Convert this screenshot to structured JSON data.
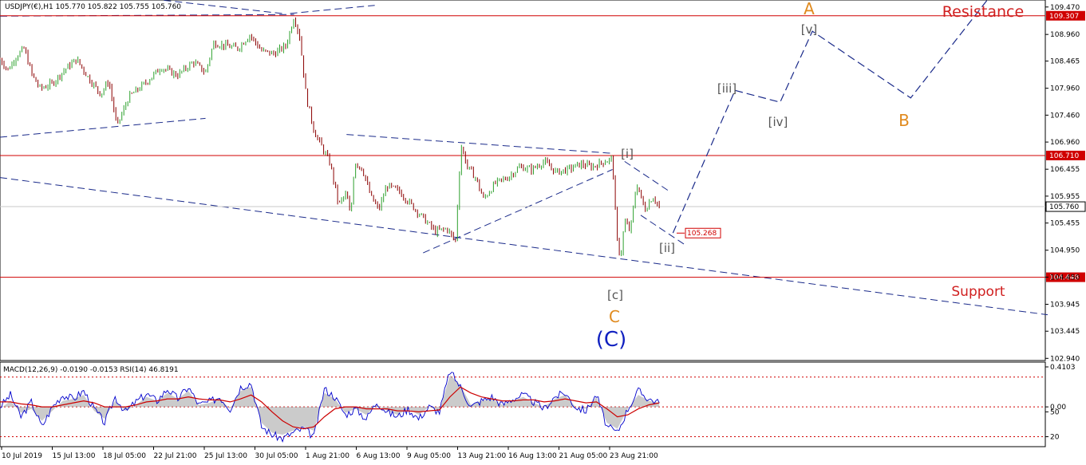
{
  "chart_data": [
    {
      "type": "candlestick",
      "symbol_header": "USDJPY(€),H1  105.770 105.822 105.755 105.760",
      "ylim": [
        102.9,
        109.6
      ],
      "price_ticks": [
        "109.470",
        "108.960",
        "108.465",
        "107.960",
        "107.460",
        "106.960",
        "106.455",
        "105.955",
        "105.455",
        "104.950",
        "104.450",
        "103.945",
        "103.445",
        "102.940"
      ],
      "x_labels": [
        "10 Jul 2019",
        "15 Jul 13:00",
        "18 Jul 05:00",
        "22 Jul 21:00",
        "25 Jul 13:00",
        "30 Jul 05:00",
        "1 Aug 21:00",
        "6 Aug 13:00",
        "9 Aug 05:00",
        "13 Aug 21:00",
        "16 Aug 13:00",
        "21 Aug 05:00",
        "23 Aug 21:00"
      ],
      "horizontal_levels": [
        {
          "value": 109.307,
          "label": "109.307",
          "color": "#d00000"
        },
        {
          "value": 106.71,
          "label": "106.710",
          "color": "#d00000"
        },
        {
          "value": 104.448,
          "label": "104.448",
          "color": "#d00000"
        },
        {
          "value": 105.268,
          "label": "105.268",
          "color": "#d00000"
        }
      ],
      "current_price": "105.760",
      "wave_labels": [
        {
          "text": "A",
          "color": "#e08a1e"
        },
        {
          "text": "[v]",
          "color": "#555555"
        },
        {
          "text": "[iii]",
          "color": "#555555"
        },
        {
          "text": "[iv]",
          "color": "#555555"
        },
        {
          "text": "B",
          "color": "#e08a1e"
        },
        {
          "text": "[i]",
          "color": "#555555"
        },
        {
          "text": "[ii]",
          "color": "#555555"
        },
        {
          "text": "[c]",
          "color": "#555555"
        },
        {
          "text": "C",
          "color": "#e08a1e"
        },
        {
          "text": "(C)",
          "color": "#1020c0"
        }
      ],
      "annotations": [
        {
          "text": "Resistance",
          "color": "#d02020"
        },
        {
          "text": "Support",
          "color": "#d02020"
        }
      ],
      "projection_path": [
        {
          "t": 0.835,
          "price": 105.27
        },
        {
          "t": 0.912,
          "price": 107.92
        },
        {
          "t": 0.968,
          "price": 107.7
        },
        {
          "t": 1.008,
          "price": 109.02
        },
        {
          "t": 1.13,
          "price": 107.78
        },
        {
          "t": 1.225,
          "price": 109.6
        }
      ],
      "price_series": [
        {
          "t": 0.0,
          "price": 108.5
        },
        {
          "t": 0.01,
          "price": 108.3
        },
        {
          "t": 0.02,
          "price": 108.55
        },
        {
          "t": 0.03,
          "price": 108.7
        },
        {
          "t": 0.04,
          "price": 108.2
        },
        {
          "t": 0.05,
          "price": 107.95
        },
        {
          "t": 0.065,
          "price": 108.05
        },
        {
          "t": 0.08,
          "price": 108.3
        },
        {
          "t": 0.095,
          "price": 108.5
        },
        {
          "t": 0.11,
          "price": 108.15
        },
        {
          "t": 0.125,
          "price": 107.85
        },
        {
          "t": 0.135,
          "price": 108.1
        },
        {
          "t": 0.145,
          "price": 107.25
        },
        {
          "t": 0.16,
          "price": 107.8
        },
        {
          "t": 0.18,
          "price": 108.05
        },
        {
          "t": 0.2,
          "price": 108.35
        },
        {
          "t": 0.22,
          "price": 108.2
        },
        {
          "t": 0.24,
          "price": 108.45
        },
        {
          "t": 0.255,
          "price": 108.25
        },
        {
          "t": 0.265,
          "price": 108.8
        },
        {
          "t": 0.28,
          "price": 108.75
        },
        {
          "t": 0.295,
          "price": 108.7
        },
        {
          "t": 0.31,
          "price": 108.95
        },
        {
          "t": 0.325,
          "price": 108.65
        },
        {
          "t": 0.34,
          "price": 108.6
        },
        {
          "t": 0.355,
          "price": 108.75
        },
        {
          "t": 0.365,
          "price": 109.3
        },
        {
          "t": 0.372,
          "price": 108.9
        },
        {
          "t": 0.38,
          "price": 107.8
        },
        {
          "t": 0.39,
          "price": 107.15
        },
        {
          "t": 0.4,
          "price": 106.85
        },
        {
          "t": 0.41,
          "price": 106.55
        },
        {
          "t": 0.42,
          "price": 105.8
        },
        {
          "t": 0.43,
          "price": 106.0
        },
        {
          "t": 0.435,
          "price": 105.55
        },
        {
          "t": 0.44,
          "price": 106.6
        },
        {
          "t": 0.45,
          "price": 106.45
        },
        {
          "t": 0.46,
          "price": 105.95
        },
        {
          "t": 0.47,
          "price": 105.7
        },
        {
          "t": 0.48,
          "price": 106.15
        },
        {
          "t": 0.495,
          "price": 106.05
        },
        {
          "t": 0.51,
          "price": 105.8
        },
        {
          "t": 0.525,
          "price": 105.55
        },
        {
          "t": 0.54,
          "price": 105.3
        },
        {
          "t": 0.555,
          "price": 105.35
        },
        {
          "t": 0.565,
          "price": 105.1
        },
        {
          "t": 0.572,
          "price": 106.9
        },
        {
          "t": 0.58,
          "price": 106.5
        },
        {
          "t": 0.59,
          "price": 106.3
        },
        {
          "t": 0.6,
          "price": 105.9
        },
        {
          "t": 0.615,
          "price": 106.2
        },
        {
          "t": 0.63,
          "price": 106.3
        },
        {
          "t": 0.645,
          "price": 106.5
        },
        {
          "t": 0.66,
          "price": 106.45
        },
        {
          "t": 0.675,
          "price": 106.6
        },
        {
          "t": 0.69,
          "price": 106.4
        },
        {
          "t": 0.705,
          "price": 106.45
        },
        {
          "t": 0.72,
          "price": 106.55
        },
        {
          "t": 0.735,
          "price": 106.5
        },
        {
          "t": 0.75,
          "price": 106.6
        },
        {
          "t": 0.76,
          "price": 106.65
        },
        {
          "t": 0.765,
          "price": 105.2
        },
        {
          "t": 0.77,
          "price": 104.8
        },
        {
          "t": 0.775,
          "price": 105.5
        },
        {
          "t": 0.782,
          "price": 105.3
        },
        {
          "t": 0.79,
          "price": 106.2
        },
        {
          "t": 0.8,
          "price": 105.7
        },
        {
          "t": 0.81,
          "price": 105.95
        },
        {
          "t": 0.818,
          "price": 105.76
        }
      ]
    },
    {
      "type": "line",
      "title": "MACD(12,26,9) -0.0190 -0.0153  RSI(14) 46.8191",
      "ylim": [
        10,
        95
      ],
      "y_ticks": [
        "0.4103",
        "0.00",
        "50",
        "20"
      ],
      "series": [
        {
          "name": "RSI(14)",
          "color": "#0000cc",
          "values": [
            50,
            62,
            40,
            55,
            30,
            50,
            62,
            58,
            66,
            48,
            34,
            60,
            45,
            55,
            63,
            56,
            68,
            58,
            70,
            52,
            55,
            60,
            48,
            70,
            74,
            30,
            22,
            18,
            24,
            28,
            20,
            68,
            60,
            42,
            48,
            38,
            55,
            45,
            40,
            48,
            38,
            50,
            45,
            86,
            70,
            50,
            56,
            60,
            52,
            58,
            62,
            55,
            48,
            60,
            64,
            50,
            46,
            62,
            30,
            24,
            48,
            66,
            58,
            54
          ]
        },
        {
          "name": "MACD signal",
          "color": "#cc0000",
          "values": [
            55,
            55,
            53,
            52,
            50,
            50,
            52,
            54,
            56,
            54,
            50,
            50,
            50,
            52,
            55,
            56,
            58,
            58,
            60,
            58,
            57,
            57,
            55,
            58,
            62,
            55,
            45,
            36,
            30,
            28,
            30,
            40,
            48,
            50,
            50,
            48,
            48,
            48,
            46,
            46,
            45,
            46,
            47,
            60,
            70,
            64,
            60,
            58,
            56,
            56,
            57,
            57,
            55,
            56,
            58,
            56,
            54,
            55,
            48,
            40,
            42,
            48,
            52,
            54
          ]
        },
        {
          "name": "MACD histogram",
          "color": "#a0a0a0",
          "values": [
            48,
            56,
            44,
            48,
            36,
            46,
            56,
            58,
            62,
            46,
            38,
            56,
            46,
            52,
            60,
            56,
            64,
            58,
            66,
            52,
            54,
            58,
            48,
            66,
            70,
            34,
            24,
            22,
            26,
            30,
            26,
            64,
            58,
            44,
            48,
            42,
            52,
            46,
            42,
            48,
            42,
            50,
            46,
            82,
            72,
            52,
            56,
            58,
            52,
            56,
            60,
            54,
            50,
            58,
            62,
            50,
            48,
            60,
            34,
            28,
            48,
            62,
            56,
            54
          ]
        }
      ],
      "reference_levels": [
        80,
        50,
        20
      ]
    }
  ]
}
